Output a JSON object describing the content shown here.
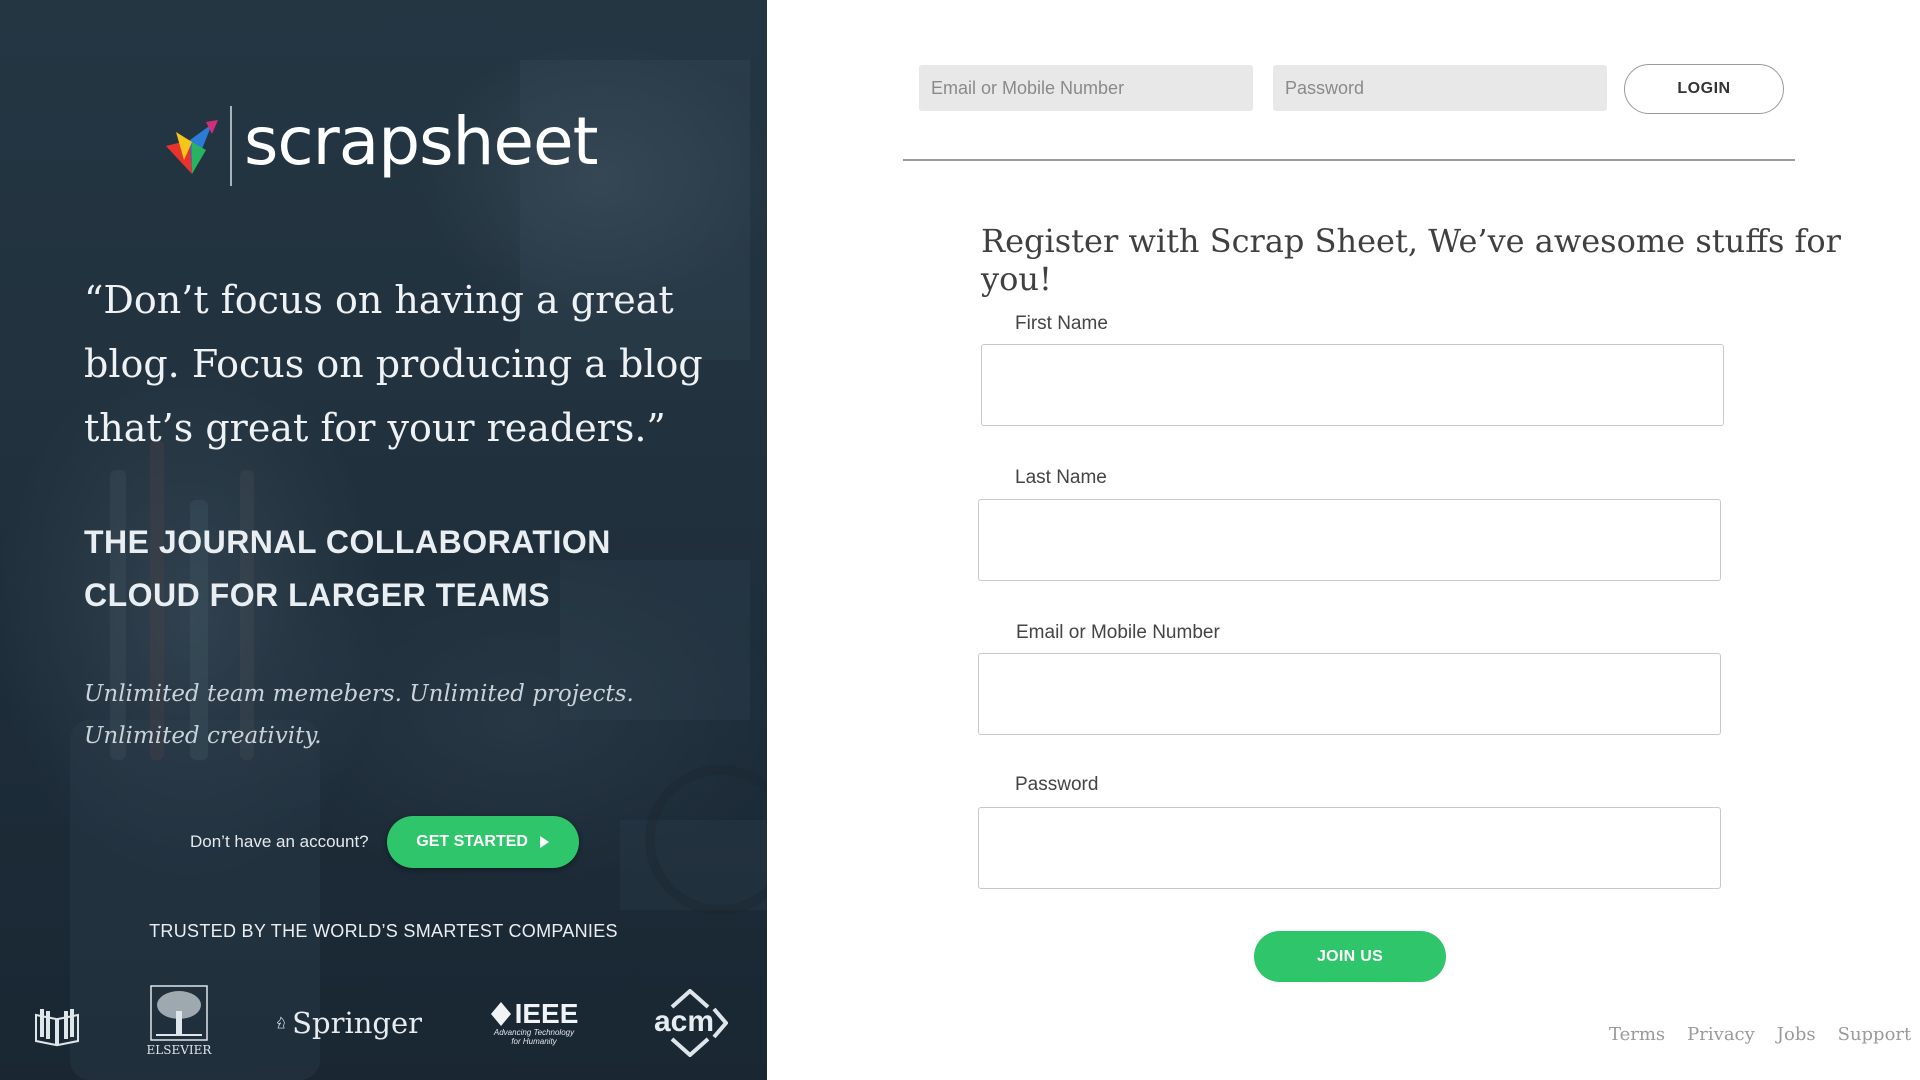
{
  "brand": {
    "name": "scrapsheet"
  },
  "left": {
    "quote": "“Don’t focus on having a great blog. Focus on producing a blog that’s great for your readers.”",
    "tagline": "THE JOURNAL COLLABORATION CLOUD FOR LARGER TEAMS",
    "subtext": "Unlimited team memebers. Unlimited projects. Unlimited creativity.",
    "cta_prompt": "Don’t have an account?",
    "cta_button": "GET STARTED",
    "trusted": "TRUSTED BY THE WORLD’S SMARTEST COMPANIES",
    "partners": {
      "ijsrp": "IJSRP.ORG",
      "elsevier": "ELSEVIER",
      "springer": "Springer",
      "ieee": "IEEE",
      "ieee_tagline": "Advancing Technology for Humanity",
      "acm": "acm"
    }
  },
  "login": {
    "email_placeholder": "Email or Mobile Number",
    "password_placeholder": "Password",
    "button": "LOGIN"
  },
  "register": {
    "title": "Register with Scrap Sheet, We’ve awesome stuffs for you!",
    "first_name_label": "First Name",
    "last_name_label": "Last Name",
    "email_label": "Email or Mobile Number",
    "password_label": "Password",
    "first_name_value": "",
    "last_name_value": "",
    "email_value": "",
    "password_value": "",
    "button": "JOIN US"
  },
  "footer": {
    "links": [
      "Terms",
      "Privacy",
      "Jobs",
      "Support"
    ]
  },
  "colors": {
    "accent": "#2fc56a",
    "panel": "#263846"
  }
}
